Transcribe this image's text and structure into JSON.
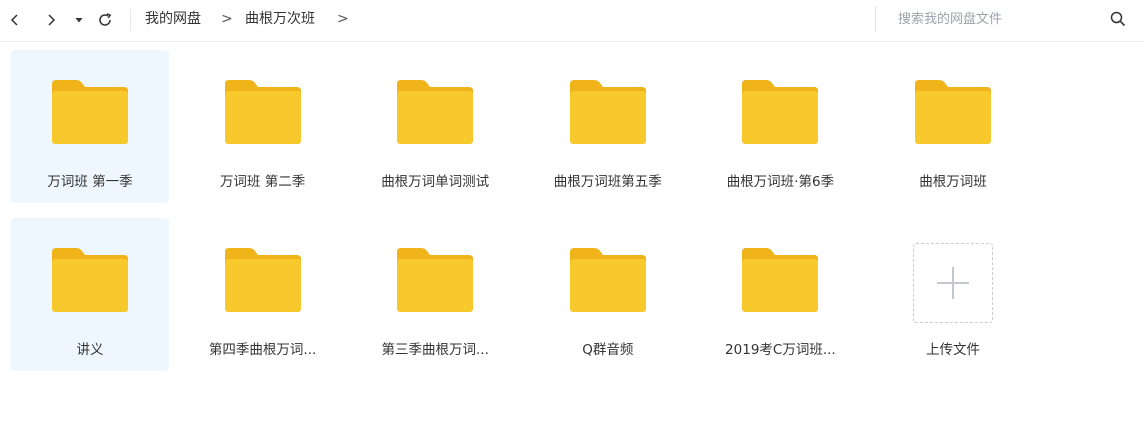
{
  "toolbar": {
    "back_icon": "chevron-left-icon",
    "forward_icon": "chevron-right-icon",
    "history_icon": "dropdown-triangle-icon",
    "refresh_icon": "refresh-icon",
    "breadcrumb": {
      "root": "我的网盘",
      "separator": ">",
      "current": "曲根万次班"
    },
    "search": {
      "placeholder": "搜索我的网盘文件",
      "value": "",
      "icon": "search-icon"
    }
  },
  "items": [
    {
      "label": "万词班  第一季",
      "type": "folder",
      "selected": true
    },
    {
      "label": "万词班  第二季",
      "type": "folder",
      "selected": false
    },
    {
      "label": "曲根万词单词测试",
      "type": "folder",
      "selected": false
    },
    {
      "label": "曲根万词班第五季",
      "type": "folder",
      "selected": false
    },
    {
      "label": "曲根万词班·第6季",
      "type": "folder",
      "selected": false
    },
    {
      "label": "曲根万词班",
      "type": "folder",
      "selected": false
    },
    {
      "label": "讲义",
      "type": "folder",
      "selected": true
    },
    {
      "label": "第四季曲根万词...",
      "type": "folder",
      "selected": false
    },
    {
      "label": "第三季曲根万词...",
      "type": "folder",
      "selected": false
    },
    {
      "label": "Q群音频",
      "type": "folder",
      "selected": false
    },
    {
      "label": "2019考C万词班...",
      "type": "folder",
      "selected": false
    }
  ],
  "upload": {
    "label": "上传文件",
    "icon": "plus-icon"
  },
  "colors": {
    "folder_body": "#f8c92c",
    "folder_tab": "#f0b41a",
    "selected_bg": "#eff7fe",
    "text": "#333333",
    "placeholder": "#9ea2ab"
  }
}
